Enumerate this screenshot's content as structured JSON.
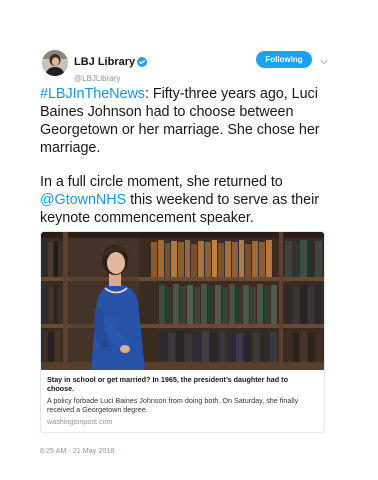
{
  "author": {
    "display_name": "LBJ Library",
    "handle": "@LBJLibrary",
    "avatar_icon": "portrait-avatar",
    "verified_icon": "verified-badge-icon"
  },
  "follow_button": {
    "label": "Following"
  },
  "tweet": {
    "p1_hashtag": "#LBJInTheNews",
    "p1_text": ": Fifty-three years ago, Luci Baines Johnson had to choose between Georgetown or her marriage. She chose her marriage.",
    "p2_text_before": "In a full circle moment, she returned to ",
    "p2_mention": "@GtownNHS",
    "p2_text_after": " this weekend to serve as their keynote commencement speaker."
  },
  "card": {
    "image_description": "woman in blue dress standing in front of library bookshelves",
    "title": "Stay in school or get married? In 1965, the president’s daughter had to choose.",
    "description": "A policy forbade Luci Baines Johnson from doing both. On Saturday, she finally received a Georgetown degree.",
    "domain": "washingtonpost.com"
  },
  "timestamp": "8:25 AM - 21 May 2018",
  "colors": {
    "accent": "#1da1f2",
    "link": "#1b95e0",
    "muted": "#8a95a0"
  }
}
